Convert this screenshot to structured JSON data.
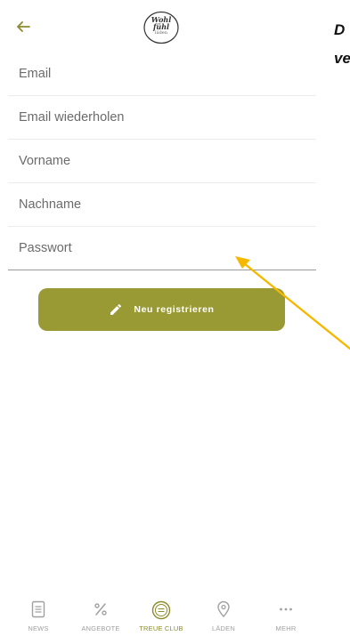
{
  "header": {
    "back_icon": "arrow-left-icon",
    "logo_lines": [
      "Wohl",
      "fühl",
      "läden"
    ]
  },
  "form": {
    "fields": [
      {
        "placeholder": "Email",
        "value": ""
      },
      {
        "placeholder": "Email wiederholen",
        "value": ""
      },
      {
        "placeholder": "Vorname",
        "value": ""
      },
      {
        "placeholder": "Nachname",
        "value": ""
      },
      {
        "placeholder": "Passwort",
        "value": ""
      }
    ],
    "submit_label": "Neu registrieren",
    "submit_icon": "pencil-icon"
  },
  "tabbar": {
    "items": [
      {
        "label": "NEWS",
        "icon": "news-icon"
      },
      {
        "label": "ANGEBOTE",
        "icon": "percent-icon"
      },
      {
        "label": "TREUE CLUB",
        "icon": "treue-club-icon",
        "active": true
      },
      {
        "label": "LÄDEN",
        "icon": "location-pin-icon"
      },
      {
        "label": "MEHR",
        "icon": "more-dots-icon"
      }
    ]
  },
  "annotation": {
    "side_text_fragments": [
      "D",
      "ve"
    ]
  },
  "colors": {
    "accent": "#9a9a35",
    "accent_text": "#8c8c2c",
    "annotation_arrow": "#f5b800",
    "inactive_tab": "#a0a0a0"
  }
}
